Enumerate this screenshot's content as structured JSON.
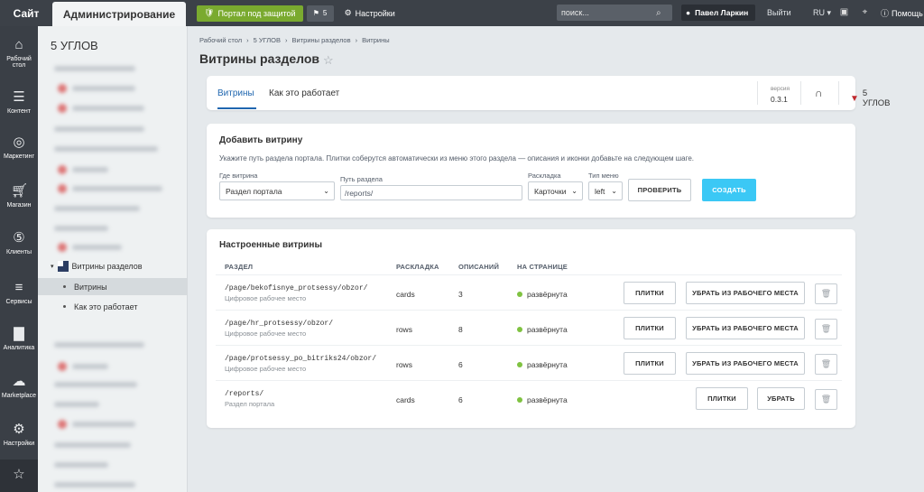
{
  "topbar": {
    "site_tab": "Сайт",
    "admin_tab": "Администрирование",
    "protect_label": "Портал под защитой",
    "notif_count": "5",
    "settings_label": "Настройки",
    "search_placeholder": "поиск...",
    "user_name": "Павел Ларкин",
    "logout_label": "Выйти",
    "lang": "RU",
    "help_label": "Помощь"
  },
  "leftbar": {
    "items": [
      {
        "label": "Рабочий стол",
        "icon": "home-icon"
      },
      {
        "label": "Контент",
        "icon": "document-icon"
      },
      {
        "label": "Маркетинг",
        "icon": "target-icon"
      },
      {
        "label": "Магазин",
        "icon": "cart-icon"
      },
      {
        "label": "Клиенты",
        "icon": "clients-icon"
      },
      {
        "label": "Сервисы",
        "icon": "layers-icon"
      },
      {
        "label": "Аналитика",
        "icon": "chart-icon"
      },
      {
        "label": "Marketplace",
        "icon": "cloud-download-icon"
      },
      {
        "label": "Настройки",
        "icon": "gear-icon"
      }
    ]
  },
  "sidebar": {
    "title": "5 УГЛОВ",
    "section_label": "Витрины разделов",
    "sub_items": [
      {
        "label": "Витрины"
      },
      {
        "label": "Как это работает"
      }
    ]
  },
  "breadcrumb": [
    "Рабочий стол",
    "5 УГЛОВ",
    "Витрины разделов",
    "Витрины"
  ],
  "page_title": "Витрины разделов",
  "tabs": [
    "Витрины",
    "Как это работает"
  ],
  "version_label": "версия",
  "version_value": "0.3.1",
  "brand_label": "5 УГЛОВ",
  "add_card": {
    "title": "Добавить витрину",
    "hint": "Укажите путь раздела портала. Плитки соберутся автоматически из меню этого раздела — описания и иконки добавьте на следующем шаге.",
    "where_label": "Где витрина",
    "where_value": "Раздел портала",
    "path_label": "Путь раздела",
    "path_value": "/reports/",
    "layout_label": "Раскладка",
    "layout_value": "Карточки",
    "menu_type_label": "Тип меню",
    "menu_type_value": "left",
    "check_btn": "ПРОВЕРИТЬ",
    "create_btn": "СОЗДАТЬ"
  },
  "list_card": {
    "title": "Настроенные витрины",
    "columns": [
      "РАЗДЕЛ",
      "РАСКЛАДКА",
      "ОПИСАНИЙ",
      "НА СТРАНИЦЕ"
    ],
    "rows": [
      {
        "path": "/page/bekofisnye_protsessy/obzor/",
        "sub": "Цифровое рабочее место",
        "layout": "cards",
        "count": "3",
        "status": "развёрнута",
        "btn1": "ПЛИТКИ",
        "btn2": "УБРАТЬ ИЗ РАБОЧЕГО МЕСТА"
      },
      {
        "path": "/page/hr_protsessy/obzor/",
        "sub": "Цифровое рабочее место",
        "layout": "rows",
        "count": "8",
        "status": "развёрнута",
        "btn1": "ПЛИТКИ",
        "btn2": "УБРАТЬ ИЗ РАБОЧЕГО МЕСТА"
      },
      {
        "path": "/page/protsessy_po_bitriks24/obzor/",
        "sub": "Цифровое рабочее место",
        "layout": "rows",
        "count": "6",
        "status": "развёрнута",
        "btn1": "ПЛИТКИ",
        "btn2": "УБРАТЬ ИЗ РАБОЧЕГО МЕСТА"
      },
      {
        "path": "/reports/",
        "sub": "Раздел портала",
        "layout": "cards",
        "count": "6",
        "status": "развёрнута",
        "btn1": "ПЛИТКИ",
        "btn2": "УБРАТЬ"
      }
    ]
  },
  "colors": {
    "topbar": "#3c4148",
    "accent_blue": "#2067b0",
    "primary_button": "#3bc8f5",
    "protect_green": "#7aaa2f",
    "status_green": "#7fc241",
    "brand_red": "#c0282d"
  }
}
